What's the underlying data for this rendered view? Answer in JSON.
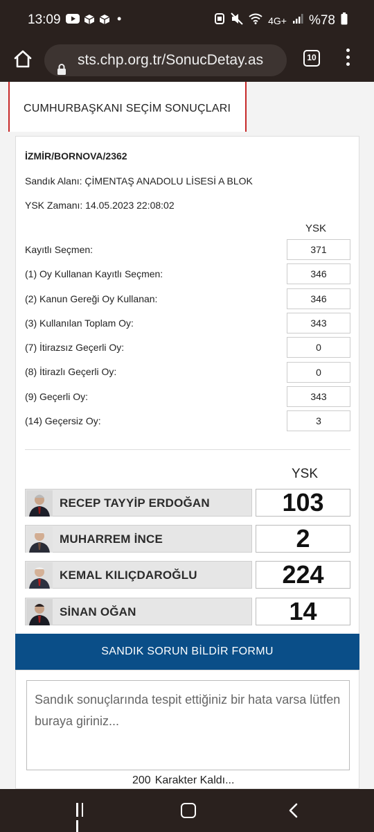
{
  "status_bar": {
    "time": "13:09",
    "battery": "%78",
    "network": "4G+"
  },
  "browser": {
    "url": "sts.chp.org.tr/SonucDetay.as",
    "tab_count": "10"
  },
  "page": {
    "header_title": "CUMHURBAŞKANI SEÇİM SONUÇLARI",
    "ballot_code": "İZMİR/BORNOVA/2362",
    "location_label": "Sandık Alanı:",
    "location_value": "ÇİMENTAŞ ANADOLU LİSESİ A BLOK",
    "ysk_time_label": "YSK Zamanı:",
    "ysk_time_value": "14.05.2023 22:08:02",
    "ysk_header": "YSK",
    "stats": [
      {
        "label": "Kayıtlı Seçmen:",
        "value": "371"
      },
      {
        "label": "(1) Oy Kullanan Kayıtlı Seçmen:",
        "value": "346"
      },
      {
        "label": "(2) Kanun Gereği Oy Kullanan:",
        "value": "346"
      },
      {
        "label": "(3) Kullanılan Toplam Oy:",
        "value": "343"
      },
      {
        "label": "(7) İtirazsız Geçerli Oy:",
        "value": "0"
      },
      {
        "label": "(8) İtirazlı Geçerli Oy:",
        "value": "0"
      },
      {
        "label": "(9) Geçerli Oy:",
        "value": "343"
      },
      {
        "label": "(14) Geçersiz Oy:",
        "value": "3"
      }
    ],
    "candidates_header": "YSK",
    "candidates": [
      {
        "name": "RECEP TAYYİP ERDOĞAN",
        "votes": "103"
      },
      {
        "name": "MUHARREM İNCE",
        "votes": "2"
      },
      {
        "name": "KEMAL KILIÇDAROĞLU",
        "votes": "224"
      },
      {
        "name": "SİNAN OĞAN",
        "votes": "14"
      }
    ],
    "form_title": "SANDIK SORUN BİLDİR FORMU",
    "form_placeholder": "Sandık sonuçlarında tespit ettiğiniz bir hata varsa lütfen buraya giriniz...",
    "chars_remaining": "200",
    "chars_label": "Karakter Kaldı..."
  },
  "colors": {
    "system_bar": "#2a211e",
    "accent_red": "#c62828",
    "form_blue": "#0a4e88"
  }
}
